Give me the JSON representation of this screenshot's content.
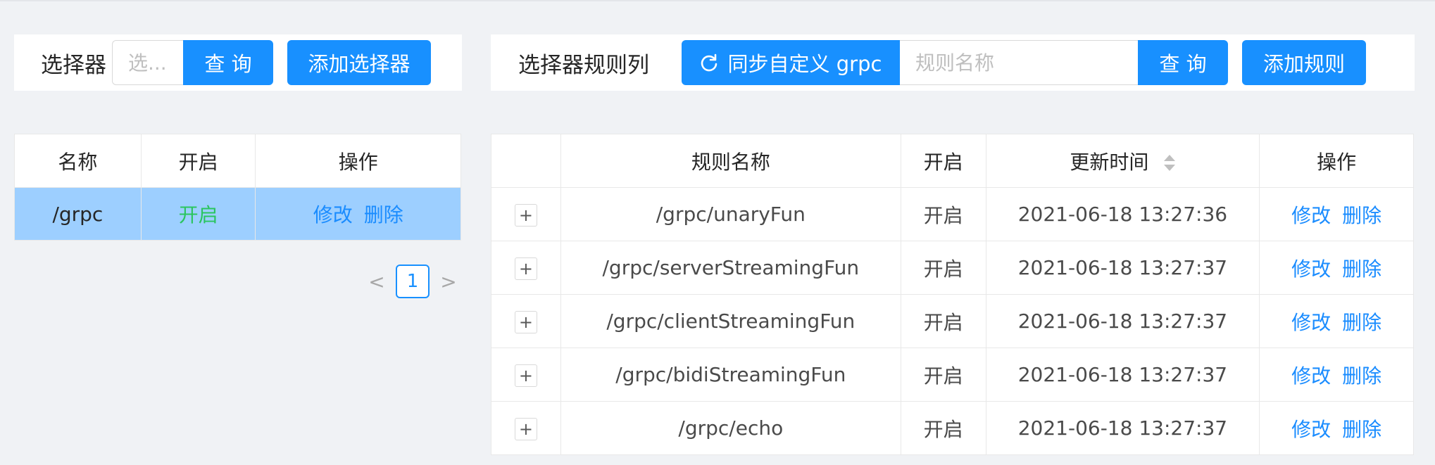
{
  "selector_panel": {
    "title": "选择器",
    "search_placeholder": "选...",
    "query_label": "查 询",
    "add_label": "添加选择器",
    "columns": [
      "名称",
      "开启",
      "操作"
    ],
    "rows": [
      {
        "name": "/grpc",
        "status": "开启",
        "edit": "修改",
        "delete": "删除",
        "selected": true
      }
    ],
    "pagination": {
      "prev": "<",
      "current": "1",
      "next": ">"
    }
  },
  "rule_panel": {
    "title": "选择器规则列",
    "sync_label": "同步自定义 grpc",
    "search_placeholder": "规则名称",
    "query_label": "查 询",
    "add_label": "添加规则",
    "columns": [
      "",
      "规则名称",
      "开启",
      "更新时间",
      "操作"
    ],
    "rows": [
      {
        "expand": "+",
        "name": "/grpc/unaryFun",
        "status": "开启",
        "updated": "2021-06-18 13:27:36",
        "edit": "修改",
        "delete": "删除"
      },
      {
        "expand": "+",
        "name": "/grpc/serverStreamingFun",
        "status": "开启",
        "updated": "2021-06-18 13:27:37",
        "edit": "修改",
        "delete": "删除"
      },
      {
        "expand": "+",
        "name": "/grpc/clientStreamingFun",
        "status": "开启",
        "updated": "2021-06-18 13:27:37",
        "edit": "修改",
        "delete": "删除"
      },
      {
        "expand": "+",
        "name": "/grpc/bidiStreamingFun",
        "status": "开启",
        "updated": "2021-06-18 13:27:37",
        "edit": "修改",
        "delete": "删除"
      },
      {
        "expand": "+",
        "name": "/grpc/echo",
        "status": "开启",
        "updated": "2021-06-18 13:27:37",
        "edit": "修改",
        "delete": "删除"
      }
    ]
  },
  "colors": {
    "primary": "#1890ff",
    "enabled": "#2ac55f",
    "link": "#1a8cff",
    "selected_row": "#9dcfff",
    "background": "#f0f2f5"
  },
  "icons": {
    "sync": "sync-icon",
    "sort": "sort-icon",
    "expand": "plus-icon"
  }
}
